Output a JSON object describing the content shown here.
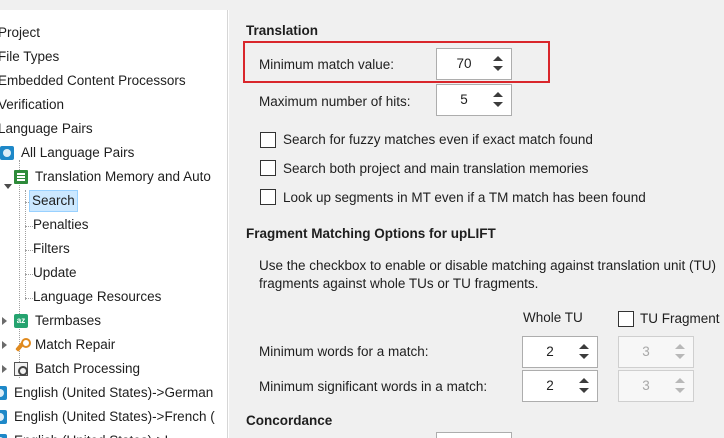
{
  "tree": {
    "items": [
      {
        "label": "Project"
      },
      {
        "label": "File Types"
      },
      {
        "label": "Embedded Content Processors"
      },
      {
        "label": "Verification"
      },
      {
        "label": "Language Pairs"
      },
      {
        "label": "All Language Pairs"
      },
      {
        "label": "Translation Memory and Auto"
      },
      {
        "label": "Search"
      },
      {
        "label": "Penalties"
      },
      {
        "label": "Filters"
      },
      {
        "label": "Update"
      },
      {
        "label": "Language Resources"
      },
      {
        "label": "Termbases"
      },
      {
        "label": "Match Repair"
      },
      {
        "label": "Batch Processing"
      },
      {
        "label": "English (United States)->German"
      },
      {
        "label": "English (United States)->French ("
      },
      {
        "label": "English (United States)->I"
      }
    ]
  },
  "translation": {
    "title": "Translation",
    "min_match_label": "Minimum match value:",
    "min_match_value": "70",
    "max_hits_label": "Maximum number of hits:",
    "max_hits_value": "5",
    "options": [
      {
        "label": "Search for fuzzy matches even if exact match found",
        "checked": false
      },
      {
        "label": "Search both project and main translation memories",
        "checked": false
      },
      {
        "label": "Look up segments in MT even if a TM match has been found",
        "checked": false
      }
    ]
  },
  "fragment": {
    "title": "Fragment Matching Options for upLIFT",
    "description_line1": "Use the checkbox to enable or disable matching against translation unit (TU)",
    "description_line2": "fragments against whole TUs or TU fragments.",
    "col_whole_tu": "Whole TU",
    "col_tu_fragment": "TU Fragment",
    "rows": [
      {
        "label": "Minimum words for a match:",
        "whole_tu": "2",
        "tu_fragment": "3"
      },
      {
        "label": "Minimum significant words in a match:",
        "whole_tu": "2",
        "tu_fragment": "3"
      }
    ]
  },
  "concordance": {
    "title": "Concordance"
  },
  "colors": {
    "highlight": "#d9262b",
    "selection": "#cce8ff"
  }
}
